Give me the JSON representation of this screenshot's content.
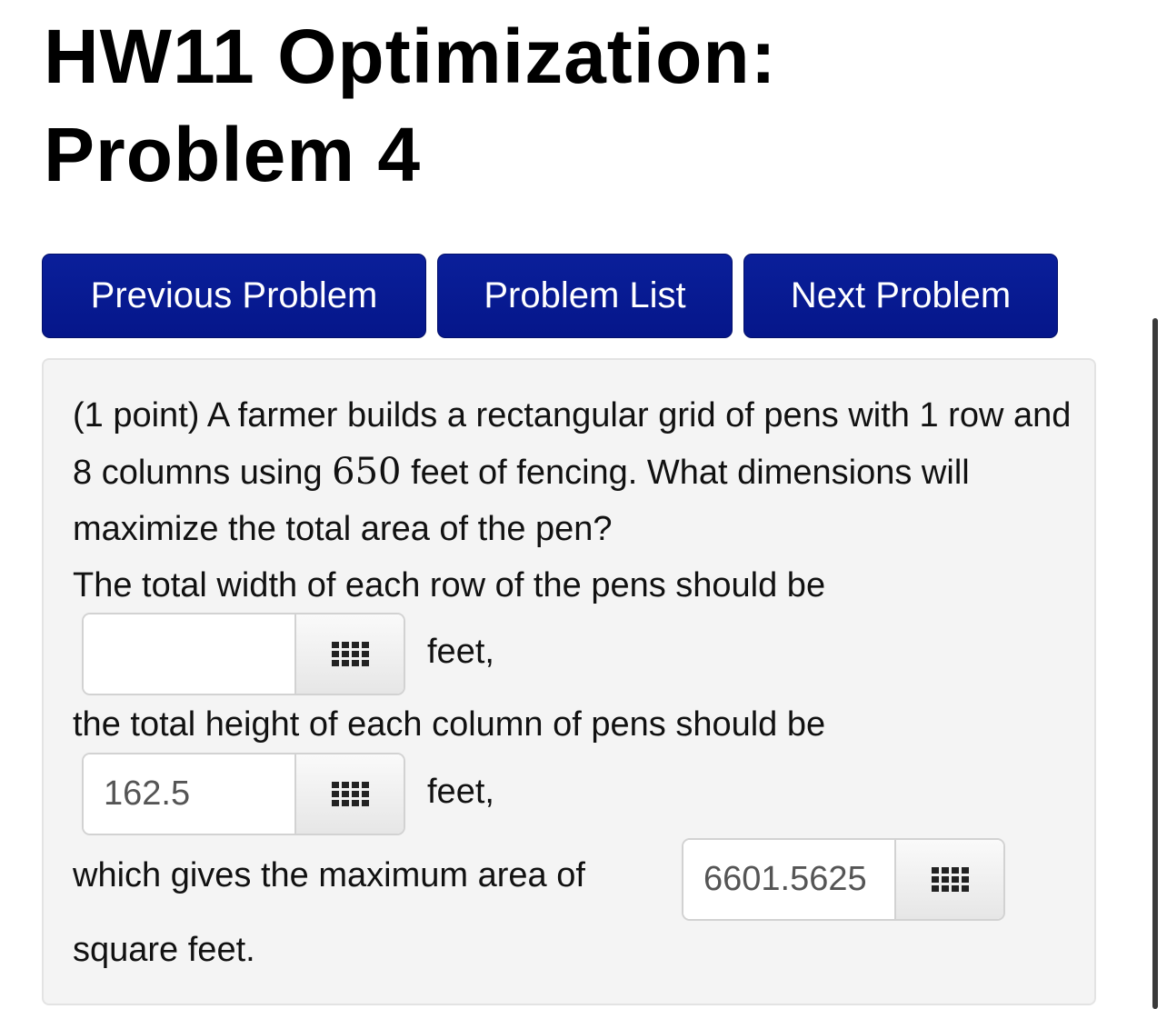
{
  "page": {
    "title_line1": "HW11 Optimization:",
    "title_line2": "Problem 4"
  },
  "nav": {
    "previous_label": "Previous Problem",
    "list_label": "Problem List",
    "next_label": "Next Problem",
    "button_color": "#05168a"
  },
  "problem": {
    "intro_before": "(1 point) A farmer builds a rectangular grid of pens with 1 row and 8 columns using ",
    "fence_amount": "650",
    "intro_after": " feet of fencing. What dimensions will maximize the total area of the pen?",
    "width_prompt": "The total width of each row of the pens should be",
    "width_value": "",
    "width_unit": "feet,",
    "height_prompt": "the total height of each column of pens should be",
    "height_value": "162.5",
    "height_unit": "feet,",
    "area_prompt": "which gives the maximum area of",
    "area_value": "6601.5625",
    "area_unit": "square feet."
  },
  "icons": {
    "keypad": "grid-icon"
  }
}
